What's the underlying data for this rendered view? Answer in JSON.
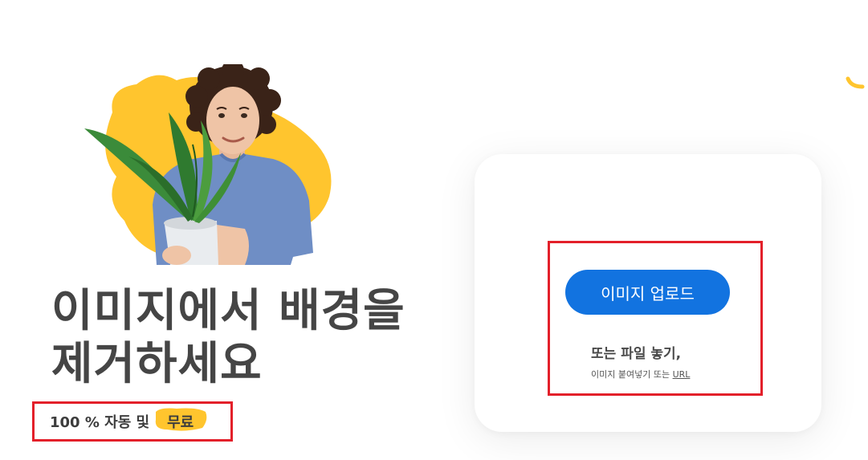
{
  "hero": {
    "headline_line1": "이미지에서 배경을",
    "headline_line2": "제거하세요",
    "subtitle_prefix": "100 % 자동 및",
    "subtitle_free": "무료"
  },
  "upload": {
    "button_label": "이미지 업로드",
    "drop_text": "또는 파일 놓기,",
    "paste_prefix": "이미지 붙여넣기 또는",
    "url_label": "URL"
  },
  "colors": {
    "accent_blue": "#1273e0",
    "brand_yellow": "#ffc52e",
    "highlight_red": "#e3202a",
    "headline_gray": "#454545"
  },
  "icons": {
    "hero_image": "person-holding-plant-image",
    "decor": "yellow-squiggle-icon"
  }
}
